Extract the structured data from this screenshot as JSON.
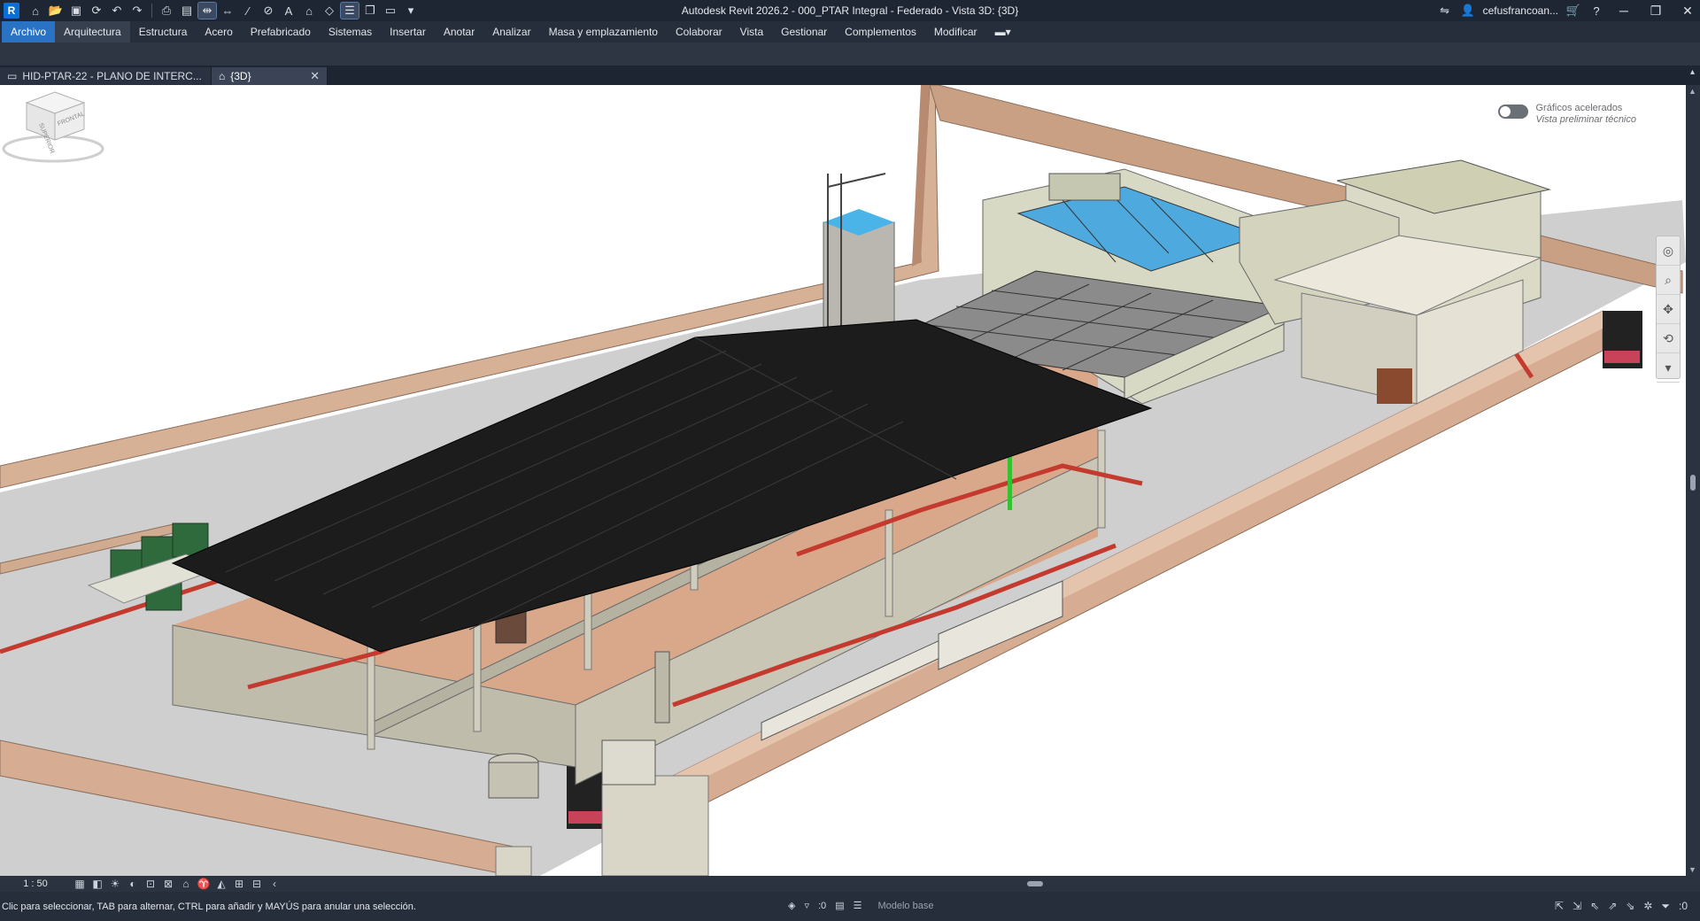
{
  "app": {
    "title": "Autodesk Revit 2026.2 - 000_PTAR Integral - Federado - Vista 3D: {3D}",
    "logo": "R",
    "user": "cefusfrancoan..."
  },
  "quick_access": [
    "home-icon",
    "open-icon",
    "save-icon",
    "sync-icon",
    "undo-icon",
    "redo-icon",
    "print-icon",
    "pdf-icon",
    "align-icon",
    "dimension-icon",
    "measure-icon",
    "tag-icon",
    "text-icon",
    "3d-view-icon",
    "section-icon",
    "thin-lines-icon",
    "close-hidden-icon",
    "switch-windows-icon",
    "customize-icon"
  ],
  "ribbon": {
    "file_label": "Archivo",
    "tabs": [
      "Arquitectura",
      "Estructura",
      "Acero",
      "Prefabricado",
      "Sistemas",
      "Insertar",
      "Anotar",
      "Analizar",
      "Masa y emplazamiento",
      "Colaborar",
      "Vista",
      "Gestionar",
      "Complementos",
      "Modificar"
    ],
    "active_tab": "Arquitectura",
    "extra": "▬▾"
  },
  "doc_tabs": [
    {
      "label": "HID-PTAR-22 - PLANO DE INTERC..."
    },
    {
      "label": "{3D}"
    }
  ],
  "viewport": {
    "graphics_line1": "Gráficos acelerados",
    "graphics_line2": "Vista preliminar técnico",
    "viewcube_top": "SUPERIOR",
    "viewcube_front": "FRONTAL"
  },
  "view_bar": {
    "scale": "1 : 50"
  },
  "status": {
    "message": "Clic para seleccionar, TAB para alternar, CTRL para añadir y MAYÚS para anular una selección.",
    "work_count": ":0",
    "model": "Modelo base",
    "filter_count": ":0"
  },
  "colors": {
    "ribbon_file": "#2a72c4",
    "titlebar": "#1f2633",
    "viewport": "#ffffff",
    "roof": "#1c1c1c",
    "wall": "#d9b49a",
    "pipe": "#c43a2e"
  }
}
